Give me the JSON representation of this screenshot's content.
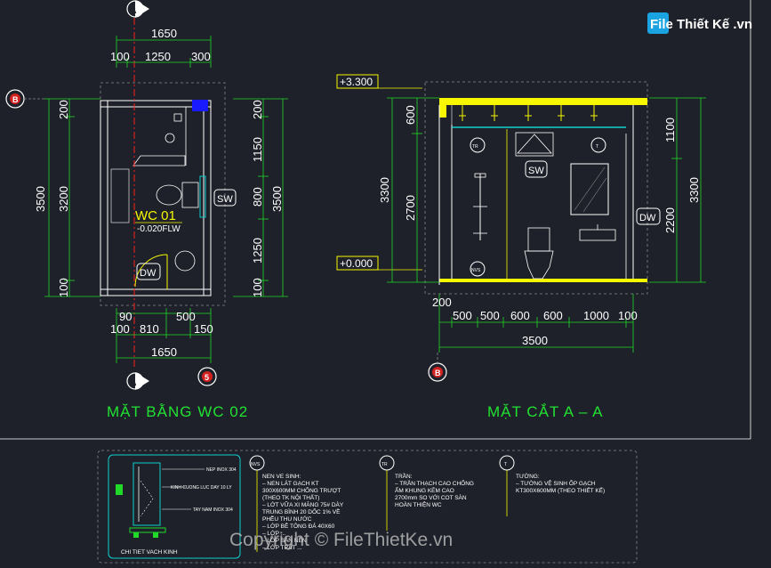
{
  "plan": {
    "title": "MẶT BẰNG WC 02",
    "room_name": "WC 01",
    "room_level": "-0.020FLW",
    "top_total": "1650",
    "top_segments": [
      "100",
      "1250",
      "300"
    ],
    "bottom_total": "1650",
    "bottom_row1": [
      "90",
      "500"
    ],
    "bottom_row2": [
      "100",
      "810",
      "150"
    ],
    "left_total": "3500",
    "left_inner": "3200",
    "left_segments": [
      "200",
      "100"
    ],
    "right_total": "3500",
    "right_segments": [
      "200",
      "1150",
      "800",
      "1250",
      "100"
    ],
    "tags": {
      "sw": "SW",
      "dw": "DW"
    },
    "markers": {
      "section_top": "A",
      "section_bottom": "A",
      "axis_left": "B",
      "axis_bottom": "5"
    }
  },
  "section": {
    "title": "MẶT CẮT A – A",
    "level_top": "+3.300",
    "level_bottom": "+0.000",
    "left_segments": [
      "600",
      "2700"
    ],
    "left_total": "3300",
    "right_segments": [
      "1100",
      "2200"
    ],
    "right_total": "3300",
    "bottom_segments": [
      "500",
      "500",
      "600",
      "600",
      "1000",
      "100"
    ],
    "bottom_extra": "200",
    "bottom_total": "3500",
    "tags": {
      "sw": "SW",
      "dw": "DW"
    },
    "markers": {
      "axis_bottom": "B",
      "tr": "TR",
      "t": "T",
      "nvs": "NVS"
    }
  },
  "legend": {
    "detail_title": "CHI TIET VACH KINH",
    "detail_labels": [
      "NEP INOX 304",
      "KINH CUONG LUC DAY 10 LY",
      "TAY NAM INOX 304"
    ],
    "items": [
      {
        "marker": "NVS",
        "heading": "NEN VE SINH:",
        "lines": [
          "– NEN LÁT GẠCH KT",
          "300X600MM CHỐNG TRƯỢT",
          "(THEO TK NỘI THẤT)",
          "– LỚT VỮA XI MĂNG 75# DÀY",
          "TRUNG BÌNH 20 DỐC 1% VỀ",
          "PHỄU THU NƯỚC",
          "– LỚP BÊ TÔNG ĐÁ 40X60",
          "– LỚP ...",
          "– LỚP SÀN NỀN",
          "– LỚP TRÁT ..."
        ]
      },
      {
        "marker": "TR",
        "heading": "TRẦN:",
        "lines": [
          "– TRẦN THẠCH CAO CHỐNG",
          "ẨM KHUNG KẼM CAO",
          "2700mm SO VỚI COT SÀN",
          "HOÀN THIỆN WC"
        ]
      },
      {
        "marker": "T",
        "heading": "TƯỜNG:",
        "lines": [
          "– TƯỜNG VỆ SINH ỐP GẠCH",
          "KT300X600MM (THEO THIẾT KẾ)"
        ]
      }
    ]
  },
  "watermark": {
    "logo": "File Thiết Kế .vn",
    "copyright": "Copyright © FileThietKe.vn"
  },
  "colors": {
    "background": "#1e2129",
    "dimension": "#21d929",
    "wall": "#ffffff",
    "highlight": "#f7f700",
    "accent_blue": "#1a1aff",
    "section_red": "#ff2020",
    "marker_red": "#d21f1f",
    "cyan": "#10d0d0"
  }
}
